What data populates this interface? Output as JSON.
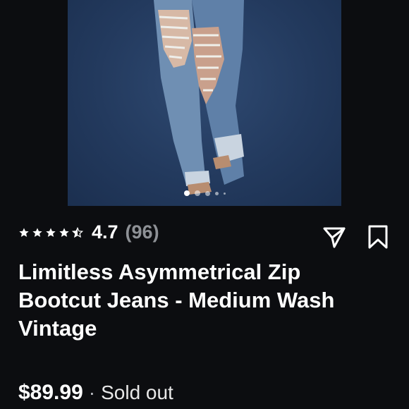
{
  "product": {
    "rating": "4.7",
    "rating_count": "(96)",
    "stars": 4.5,
    "title": "Limitless Asymmetrical Zip Bootcut Jeans - Medium Wash Vintage",
    "price": "$89.99",
    "separator": "·",
    "status": "Sold out"
  },
  "gallery": {
    "image_count": 5,
    "active_index": 0
  },
  "icons": {
    "star": "star-icon",
    "half_star": "half-star-icon",
    "share": "send-icon",
    "bookmark": "bookmark-icon"
  },
  "colors": {
    "background": "#0c0d10",
    "photo_backdrop": "#233a5e",
    "muted_text": "#8e9196"
  }
}
